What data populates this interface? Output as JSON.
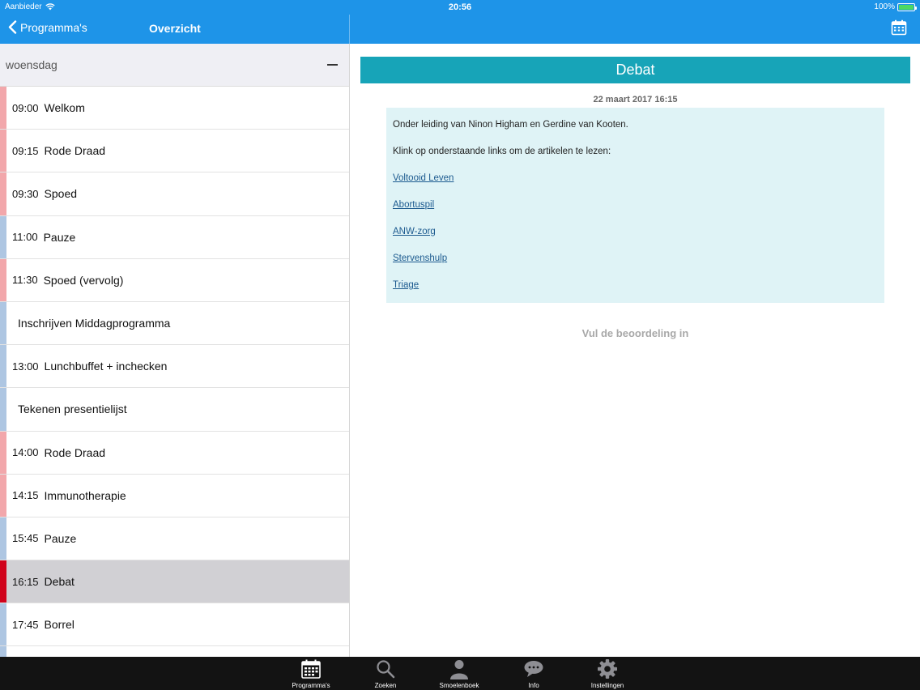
{
  "status": {
    "carrier": "Aanbieder",
    "time": "20:56",
    "battery": "100%"
  },
  "nav": {
    "back_label": "Programma's",
    "title": "Overzicht"
  },
  "colors": {
    "header": "#1e94e8",
    "pink": "#f2a7ab",
    "blue": "#aec6e2",
    "red": "#d0021b",
    "teal": "#17a4b8"
  },
  "schedule": {
    "day": "woensdag",
    "items": [
      {
        "time": "09:00",
        "label": "Welkom",
        "color": "#f2a7ab"
      },
      {
        "time": "09:15",
        "label": "Rode Draad",
        "color": "#f2a7ab"
      },
      {
        "time": "09:30",
        "label": "Spoed",
        "color": "#f2a7ab"
      },
      {
        "time": "11:00",
        "label": "Pauze",
        "color": "#aec6e2"
      },
      {
        "time": "11:30",
        "label": "Spoed (vervolg)",
        "color": "#f2a7ab"
      },
      {
        "time": "",
        "label": "Inschrijven Middagprogramma",
        "color": "#aec6e2"
      },
      {
        "time": "13:00",
        "label": "Lunchbuffet + inchecken",
        "color": "#aec6e2"
      },
      {
        "time": "",
        "label": "Tekenen presentielijst",
        "color": "#aec6e2"
      },
      {
        "time": "14:00",
        "label": "Rode Draad",
        "color": "#f2a7ab"
      },
      {
        "time": "14:15",
        "label": "Immunotherapie",
        "color": "#f2a7ab"
      },
      {
        "time": "15:45",
        "label": "Pauze",
        "color": "#aec6e2"
      },
      {
        "time": "16:15",
        "label": "Debat",
        "color": "#d0021b",
        "selected": true
      },
      {
        "time": "17:45",
        "label": "Borrel",
        "color": "#aec6e2"
      },
      {
        "time": "",
        "label": "",
        "color": "#aec6e2"
      }
    ]
  },
  "detail": {
    "title": "Debat",
    "datetime": "22 maart 2017 16:15",
    "intro": "Onder leiding van Ninon Higham en Gerdine van Kooten.",
    "instruction": "Klink op onderstaande links om de artikelen te lezen:",
    "links": [
      "Voltooid Leven",
      "Abortuspil",
      "ANW-zorg",
      "Stervenshulp",
      "Triage"
    ],
    "rating_label": "Vul de beoordeling in"
  },
  "tabbar": {
    "tabs": [
      {
        "label": "Programma's",
        "icon": "calendar-icon"
      },
      {
        "label": "Zoeken",
        "icon": "search-icon"
      },
      {
        "label": "Smoelenboek",
        "icon": "person-icon"
      },
      {
        "label": "Info",
        "icon": "chat-bubble-icon"
      },
      {
        "label": "Instellingen",
        "icon": "gear-icon"
      }
    ]
  }
}
